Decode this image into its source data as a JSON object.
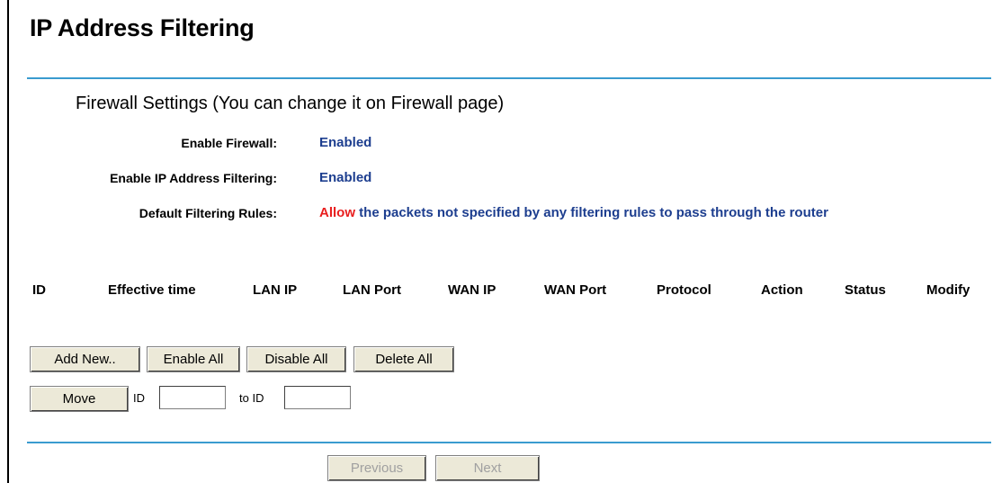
{
  "page": {
    "title": "IP Address Filtering"
  },
  "firewall": {
    "section_title": "Firewall Settings (You can change it on Firewall page)",
    "enable_firewall_label": "Enable Firewall:",
    "enable_firewall_value": "Enabled",
    "enable_ip_filtering_label": "Enable IP Address Filtering:",
    "enable_ip_filtering_value": "Enabled",
    "default_rules_label": "Default Filtering Rules:",
    "default_rules_action": "Allow",
    "default_rules_text": " the packets not specified by any filtering rules to pass through the router"
  },
  "table": {
    "columns": [
      "ID",
      "Effective time",
      "LAN IP",
      "LAN Port",
      "WAN IP",
      "WAN Port",
      "Protocol",
      "Action",
      "Status",
      "Modify"
    ]
  },
  "buttons": {
    "add_new": "Add New..",
    "enable_all": "Enable All",
    "disable_all": "Disable All",
    "delete_all": "Delete All",
    "move": "Move",
    "previous": "Previous",
    "next": "Next"
  },
  "move": {
    "id_label": "ID",
    "to_id_label": "to ID",
    "id_value": "",
    "to_id_value": ""
  },
  "colors": {
    "rule_line": "#3a9bcf",
    "value_text": "#1d3e8f",
    "allow_text": "#e81e1e"
  }
}
